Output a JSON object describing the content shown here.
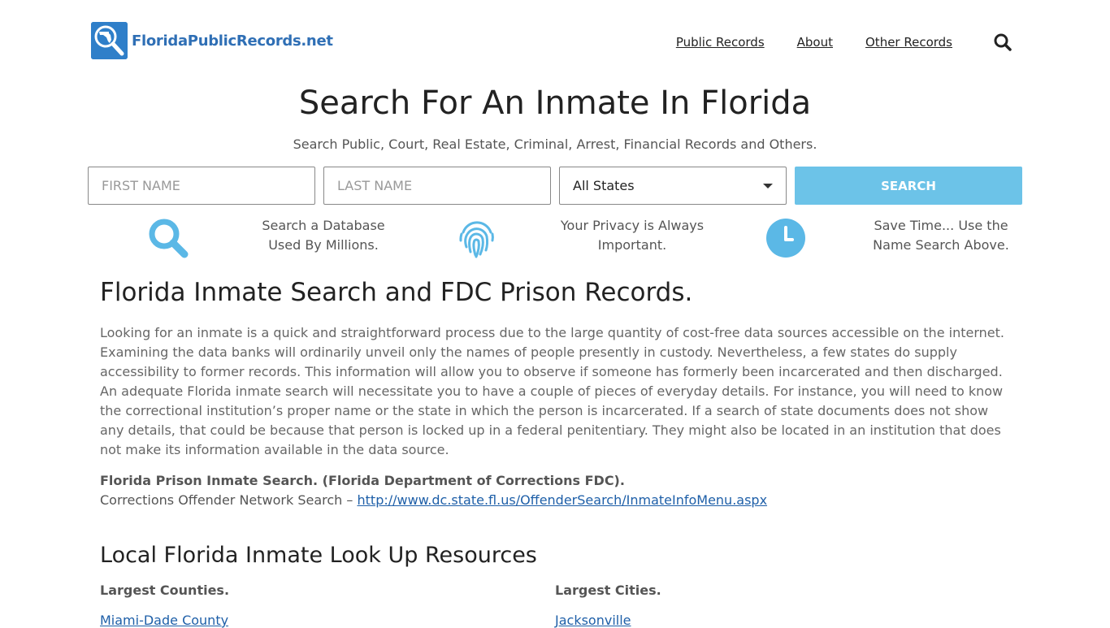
{
  "header": {
    "logo_text": "FloridaPublicRecords.net",
    "nav": [
      {
        "label": "Public Records"
      },
      {
        "label": "About"
      },
      {
        "label": "Other Records"
      }
    ]
  },
  "hero": {
    "title": "Search For An Inmate In Florida",
    "subtitle": "Search Public, Court, Real Estate, Criminal, Arrest, Financial Records and Others."
  },
  "search": {
    "first_name_placeholder": "FIRST NAME",
    "last_name_placeholder": "LAST NAME",
    "state_selected": "All States",
    "button_label": "SEARCH"
  },
  "features": [
    {
      "icon": "search-icon",
      "line1": "Search a Database",
      "line2": "Used By Millions."
    },
    {
      "icon": "fingerprint-icon",
      "line1": "Your Privacy is Always",
      "line2": "Important."
    },
    {
      "icon": "clock-icon",
      "line1": "Save Time... Use the",
      "line2": "Name Search Above."
    }
  ],
  "content": {
    "heading": "Florida Inmate Search and FDC Prison Records.",
    "paragraph": "Looking for an inmate is a quick and straightforward process due to the large quantity of cost-free data sources accessible on the internet. Examining the data banks will ordinarily unveil only the names of people presently in custody. Nevertheless, a few states do supply accessibility to former records. This information will allow you to observe if someone has formerly been incarcerated and then discharged. An adequate Florida inmate search will necessitate you to have a couple of pieces of everyday details. For instance, you will need to know the correctional institution’s proper name or the state in which the person is incarcerated. If a search of state documents does not show any details, that could be because that person is locked up in a federal penitentiary. They might also be located in an institution that does not make its information available in the data source.",
    "prison_search_title": "Florida Prison Inmate Search. (Florida Department of Corrections FDC).",
    "offender_label": "Corrections Offender Network Search – ",
    "offender_link": "http://www.dc.state.fl.us/OffenderSearch/InmateInfoMenu.aspx",
    "local_heading": "Local Florida Inmate Look Up Resources",
    "counties_label": "Largest Counties.",
    "cities_label": "Largest Cities.",
    "first_county": "Miami-Dade County",
    "first_city": "Jacksonville"
  },
  "colors": {
    "brand": "#2f7fc9",
    "accent": "#6cc3e8",
    "link": "#1e5fa8"
  }
}
